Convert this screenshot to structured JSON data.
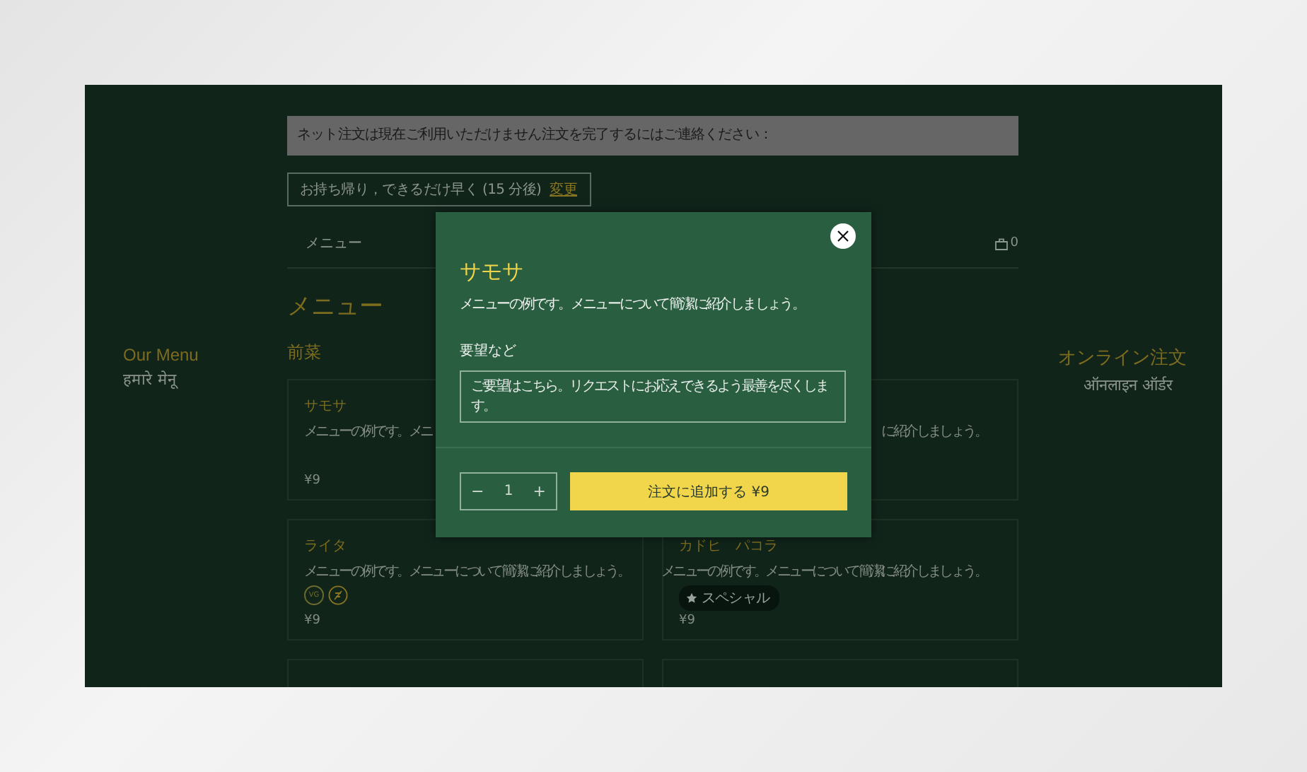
{
  "side_left": {
    "title": "Our Menu",
    "subtitle": "हमारे मेनू"
  },
  "side_right": {
    "title": "オンライン注文",
    "subtitle": "ऑनलाइन ऑर्डर"
  },
  "notice": "ネット注文は現在ご利用いただけません注文を完了するにはご連絡ください：",
  "pickup": {
    "text": "お持ち帰り，できるだけ早く (15 分後)",
    "link": "変更"
  },
  "nav": {
    "tab": "メニュー",
    "cart_count": "0"
  },
  "heading": "メニュー",
  "section": "前菜",
  "cards": [
    {
      "name": "サモサ",
      "description": "メニューの例です。メニ",
      "price": "¥9"
    },
    {
      "description": "に紹介しましょう。"
    },
    {
      "name": "ライタ",
      "description": "メニューの例です。メニューについて簡潔に紹介しましょう。",
      "tags": [
        {
          "kind": "vegan",
          "text": "VG"
        },
        {
          "kind": "crossed"
        }
      ],
      "price": "¥9"
    },
    {
      "name": "カドヒ　パコラ",
      "description": "メニューの例です。メニューについて簡潔に紹介しましょう。",
      "badge": "スペシャル",
      "price": "¥9"
    }
  ],
  "modal": {
    "title": "サモサ",
    "description": "メニューの例です。メニューについて簡潔に紹介しましょう。",
    "field_label": "要望など",
    "field_placeholder": "ご要望はこちら。リクエストにお応えできるよう最善を尽くします。",
    "quantity": "1",
    "minus": "−",
    "plus": "+",
    "add_button": "注文に追加する ¥9"
  }
}
